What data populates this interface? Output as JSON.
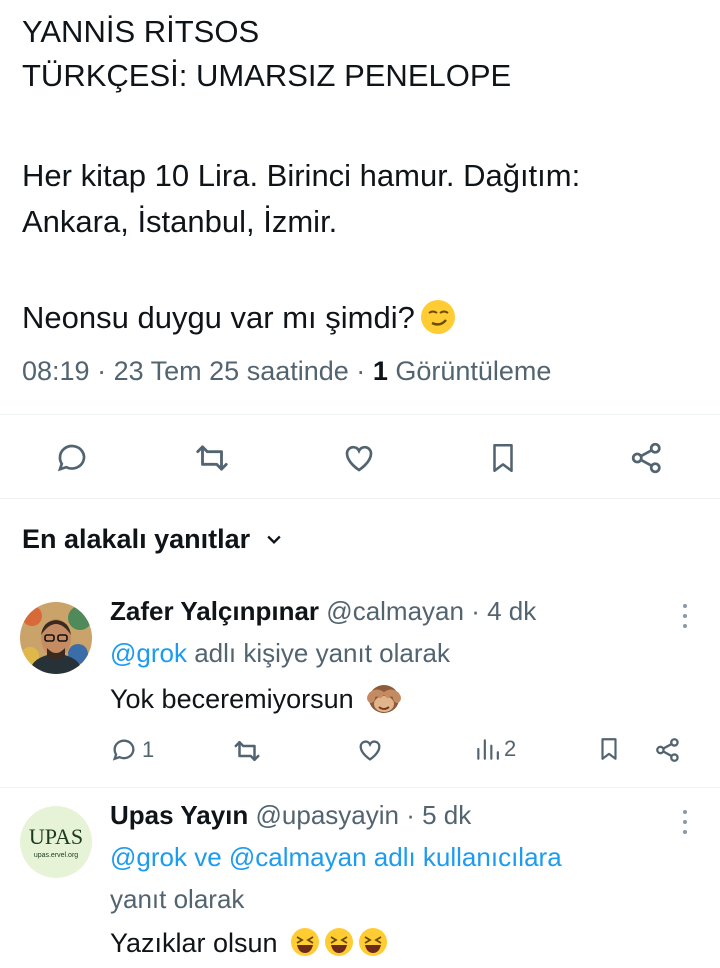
{
  "tweet": {
    "lines": [
      "YANNİS RİTSOS",
      "TÜRKÇESİ: UMARSIZ PENELOPE",
      "Her kitap 10 Lira. Birinci hamur. Dağıtım:",
      "Ankara, İstanbul, İzmir.",
      "Neonsu duygu var mı şimdi?"
    ],
    "time": "08:19",
    "date": "23 Tem 25 saatinde",
    "views_count": "1",
    "views_label": "Görüntüleme",
    "sep": "·"
  },
  "replies_section": {
    "title": "En alakalı yanıtlar"
  },
  "replies": [
    {
      "name": "Zafer Yalçınpınar",
      "handle": "@calmayan",
      "age": "· 4 dk",
      "reply_to_link": "@grok",
      "reply_to_rest": " adlı kişiye yanıt olarak",
      "body": "Yok beceremiyorsun",
      "reply_count": "1",
      "view_count": "2"
    },
    {
      "name": "Upas Yayın",
      "handle": "@upasyayin",
      "age": "· 5 dk",
      "reply_to_link": "@grok ve @calmayan adlı kullanıcılara",
      "reply_to_rest": "yanıt olarak",
      "body": "Yazıklar olsun",
      "avatar_text": "UPAS",
      "avatar_sub": "upas.ervel.org"
    }
  ],
  "colors": {
    "accent": "#1d9bf0",
    "muted": "#536471",
    "text": "#0f1419"
  }
}
